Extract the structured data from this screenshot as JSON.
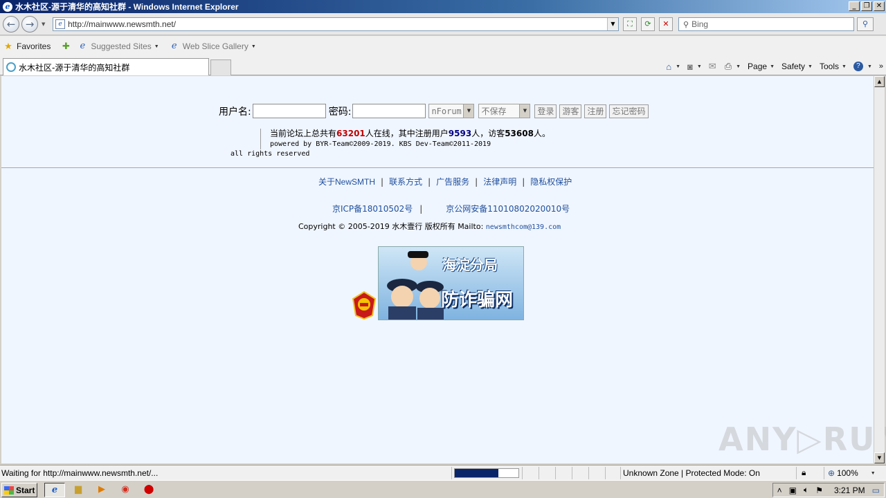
{
  "window": {
    "title": "水木社区-源于清华的高知社群 - Windows Internet Explorer",
    "minimize": "_",
    "restore": "❐",
    "close": "✕"
  },
  "toolbar": {
    "url": "http://mainwww.newsmth.net/",
    "search_placeholder": "Bing",
    "search_icon": "search-icon"
  },
  "favorites_bar": {
    "favorites_label": "Favorites",
    "items": [
      {
        "label": "Suggested Sites"
      },
      {
        "label": "Web Slice Gallery"
      }
    ]
  },
  "tabs": {
    "active_label": "水木社区-源于清华的高知社群"
  },
  "command_bar": {
    "page_label": "Page",
    "safety_label": "Safety",
    "tools_label": "Tools"
  },
  "login": {
    "username_label": "用户名:",
    "password_label": "密码:",
    "mode_value": "nForum",
    "save_value": "不保存",
    "login_btn": "登录",
    "guest_btn": "游客",
    "register_btn": "注册",
    "forgot_btn": "忘记密码"
  },
  "stats": {
    "prefix": "当前论坛上总共有",
    "online": "63201",
    "mid1": "人在线，其中注册用户",
    "registered": "9593",
    "mid2": "人，访客",
    "guests": "53608",
    "suffix": "人。",
    "powered": "powered by BYR-Team©2009-2019. KBS Dev-Team©2011-2019",
    "rights": "all rights reserved"
  },
  "footer": {
    "links": [
      "关于NewSMTH",
      "联系方式",
      "广告服务",
      "法律声明",
      "隐私权保护"
    ],
    "sep": "|",
    "icp": "京ICP备18010502号",
    "police": "京公网安备11010802020010号",
    "copyright": "Copyright © 2005-2019 水木壹行 版权所有 Mailto:",
    "email": "newsmthcom@139.com"
  },
  "banner": {
    "line1": "海淀分局",
    "line2": "防诈骗网"
  },
  "status_bar": {
    "text": "Waiting for http://mainwww.newsmth.net/...",
    "progress": 0.68,
    "zone": "Unknown Zone | Protected Mode: On",
    "zoom": "100%"
  },
  "taskbar": {
    "start_label": "Start",
    "time": "3:21 PM"
  },
  "watermark": "ANY▷RUN"
}
